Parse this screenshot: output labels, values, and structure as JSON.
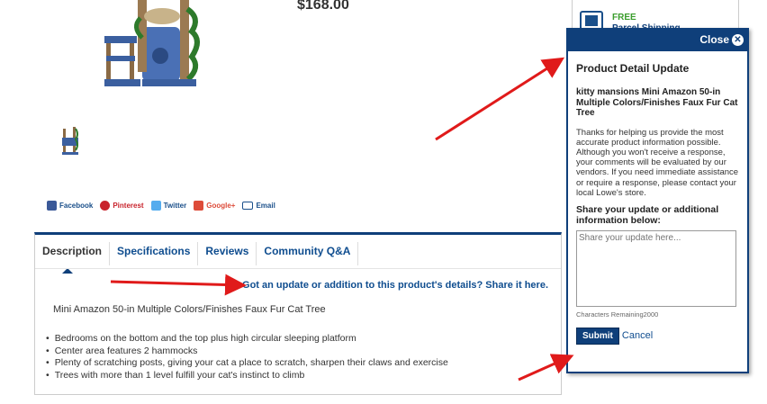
{
  "product": {
    "price": "$168.00"
  },
  "shipping": {
    "free_label": "FREE",
    "rest_label": "Parcel Shipping"
  },
  "share": {
    "facebook": "Facebook",
    "pinterest": "Pinterest",
    "twitter": "Twitter",
    "googleplus": "Google+",
    "email": "Email"
  },
  "tabs": {
    "description": "Description",
    "specifications": "Specifications",
    "reviews": "Reviews",
    "community": "Community Q&A"
  },
  "description": {
    "update_link": "Got an update or addition to this product's details? Share it here.",
    "title": "Mini Amazon 50-in Multiple Colors/Finishes Faux Fur Cat Tree",
    "bullets": [
      "Bedrooms on the bottom and the top plus high circular sleeping platform",
      "Center area features 2 hammocks",
      "Plenty of scratching posts, giving your cat a place to scratch, sharpen their claws and exercise",
      "Trees with more than 1 level fulfill your cat's instinct to climb"
    ]
  },
  "modal": {
    "close_label": "Close",
    "close_icon": "close-icon",
    "title": "Product Detail Update",
    "product_name": "kitty mansions Mini Amazon 50-in Multiple Colors/Finishes Faux Fur Cat Tree",
    "body": "Thanks for helping us provide the most accurate product information possible. Although you won't receive a response, your comments will be evaluated by our vendors. If you need immediate assistance or require a response, please contact your local Lowe's store.",
    "prompt": "Share your update or additional information below:",
    "textarea_placeholder": "Share your update here...",
    "chars_remaining": "Characters Remaining2000",
    "submit_label": "Submit",
    "cancel_label": "Cancel"
  },
  "colors": {
    "brand_blue": "#0f3f7a",
    "link_blue": "#0f4d8f",
    "arrow_red": "#e01a1a",
    "free_green": "#3a9d2c"
  }
}
